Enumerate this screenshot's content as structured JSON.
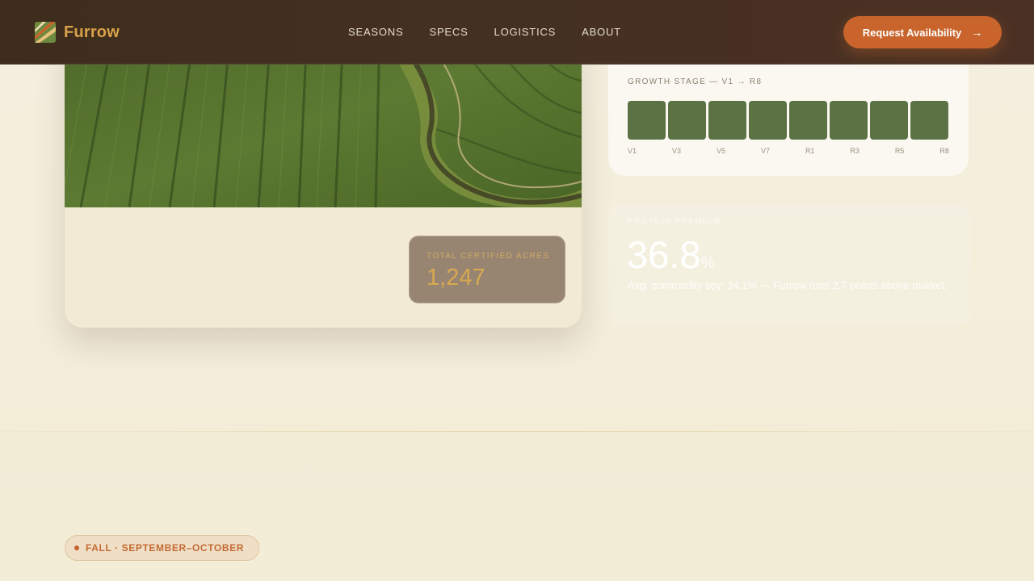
{
  "brand": {
    "name": "Furrow",
    "logo_icon": "furrow-field-logo-icon"
  },
  "nav": {
    "links": [
      "SEASONS",
      "SPECS",
      "LOGISTICS",
      "ABOUT"
    ],
    "cta_label": "Request Availability",
    "cta_icon": "arrow-right-icon"
  },
  "hero": {
    "acres_label": "TOTAL CERTIFIED ACRES",
    "acres_value": "1,247"
  },
  "growth": {
    "title": "GROWTH STAGE — V1 → R8",
    "stage_count": 8,
    "stage_labels": [
      "V1",
      "V3",
      "V5",
      "V7",
      "R1",
      "R3",
      "R5",
      "R8"
    ],
    "bar_color": "#5b7244"
  },
  "stat": {
    "label": "PROTEIN PREMIUM",
    "value": "36.8",
    "unit": "%",
    "description": "Avg. commodity soy: 34.1% — Furrow runs 2.7 points above market."
  },
  "season": {
    "label": "FALL · SEPTEMBER–OCTOBER"
  },
  "colors": {
    "accent": "#c9652c",
    "brand": "#d9a24a",
    "nav_bg": "#3e2c1c"
  }
}
